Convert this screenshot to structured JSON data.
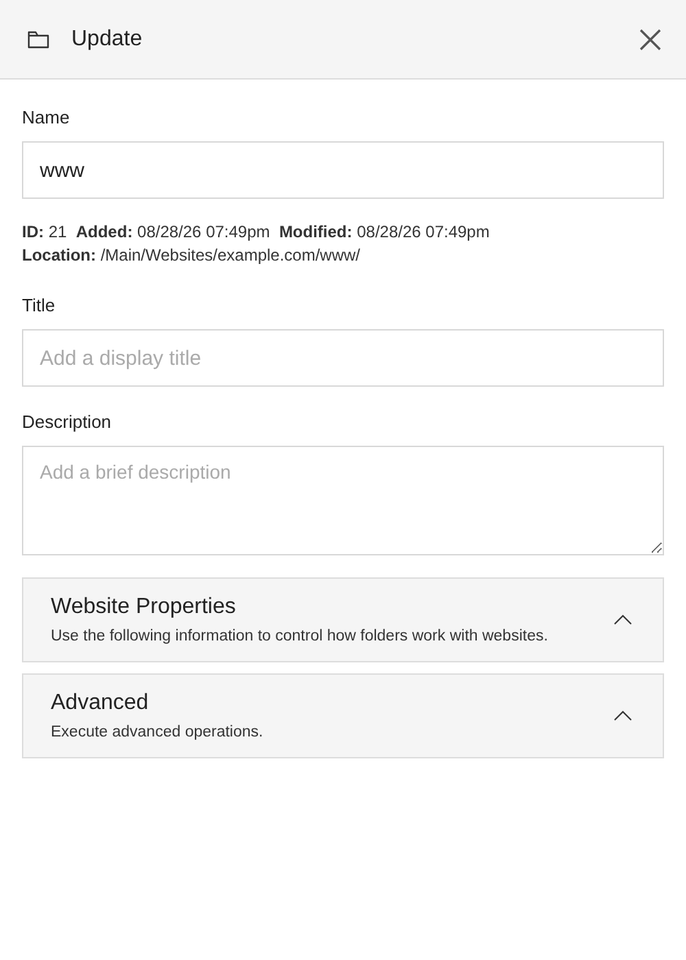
{
  "dialog": {
    "title": "Update"
  },
  "name_field": {
    "label": "Name",
    "value": "www"
  },
  "meta_lines": [
    "**ID:** 21  **Added:** 08/28/26 07:49pm  **Modified:** 08/28/26 07:49pm",
    "**Location:** /Main/Websites/example.com/www/"
  ],
  "title_field": {
    "label": "Title",
    "placeholder": "Add a display title"
  },
  "description_field": {
    "label": "Description",
    "placeholder": "Add a brief description"
  },
  "sections": [
    {
      "title": "Website Properties",
      "subtitle": "Use the following information to control how folders work with websites."
    },
    {
      "title": "Advanced",
      "subtitle": "Execute advanced operations."
    }
  ]
}
